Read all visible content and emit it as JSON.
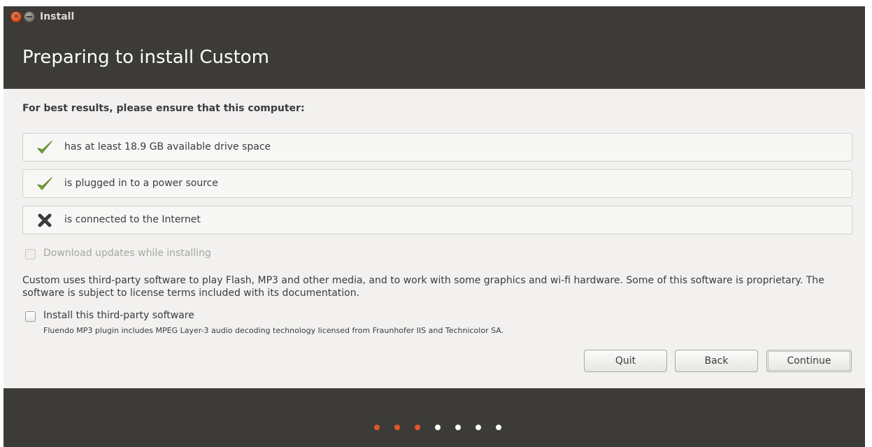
{
  "window": {
    "title": "Install"
  },
  "header": {
    "title": "Preparing to install Custom"
  },
  "requirements": {
    "lead": "For best results, please ensure that this computer:",
    "items": [
      {
        "label": "has at least 18.9 GB available drive space",
        "status": "ok",
        "icon": "checkmark-icon"
      },
      {
        "label": "is plugged in to a power source",
        "status": "ok",
        "icon": "checkmark-icon"
      },
      {
        "label": "is connected to the Internet",
        "status": "fail",
        "icon": "cross-icon"
      }
    ]
  },
  "options": {
    "download_updates": {
      "label": "Download updates while installing",
      "checked": false,
      "enabled": false
    },
    "third_party_paragraph": "Custom uses third-party software to play Flash, MP3 and other media, and to work with some graphics and wi-fi hardware. Some of this software is proprietary. The software is subject to license terms included with its documentation.",
    "third_party": {
      "label": "Install this third-party software",
      "checked": false,
      "enabled": true
    },
    "mp3_note": "Fluendo MP3 plugin includes MPEG Layer-3 audio decoding technology licensed from Fraunhofer IIS and Technicolor SA."
  },
  "buttons": {
    "quit": "Quit",
    "back": "Back",
    "continue": "Continue"
  },
  "progress": {
    "current_step": 3,
    "total_steps": 7,
    "active_color": "#e2562a",
    "inactive_color": "#ffffff"
  },
  "colors": {
    "titlebar": "#3c3b37",
    "content_bg": "#f2f1f0",
    "check_green": "#7aa63a",
    "cross_gray": "#3c3c3c"
  }
}
